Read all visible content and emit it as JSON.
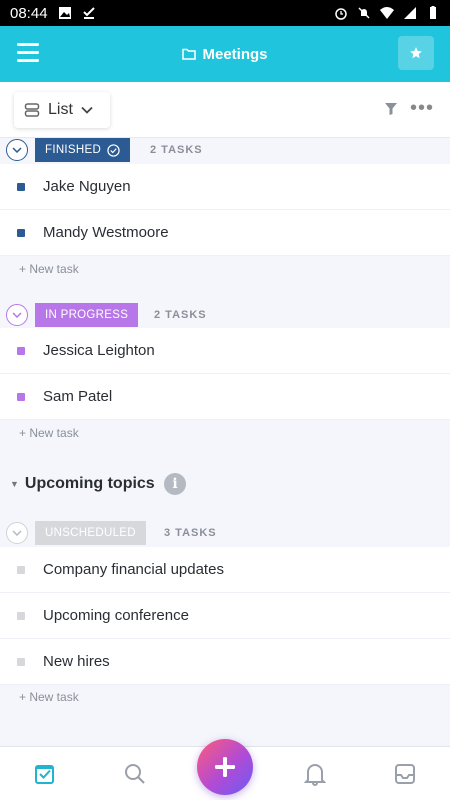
{
  "status_bar": {
    "time": "08:44",
    "left_icons": [
      "image-icon",
      "check-download-icon"
    ],
    "right_icons": [
      "alarm-icon",
      "mute-icon",
      "wifi-icon",
      "signal-icon",
      "battery-icon"
    ]
  },
  "appbar": {
    "title": "Meetings",
    "title_icon": "folder-icon",
    "background": "#20c5dd"
  },
  "toolbar": {
    "view_label": "List",
    "view_icon": "list-view-icon"
  },
  "sections": [
    {
      "status_label": "FINISHED",
      "status_color": "#2c5a92",
      "count_label": "2 TASKS",
      "tasks": [
        "Jake Nguyen",
        "Mandy Westmoore"
      ],
      "new_task_label": "+ New task"
    },
    {
      "status_label": "IN PROGRESS",
      "status_color": "#b877e8",
      "count_label": "2 TASKS",
      "tasks": [
        "Jessica Leighton",
        "Sam Patel"
      ],
      "new_task_label": "+ New task"
    }
  ],
  "group": {
    "title": "Upcoming topics",
    "info_icon": "i",
    "section": {
      "status_label": "UNSCHEDULED",
      "status_color": "#d6d8dc",
      "count_label": "3 TASKS",
      "tasks": [
        "Company financial updates",
        "Upcoming conference",
        "New hires"
      ],
      "new_task_label": "+ New task"
    }
  },
  "bottom_nav": {
    "items": [
      "tasks-icon",
      "search-icon",
      "add-icon",
      "notifications-icon",
      "inbox-icon"
    ],
    "active": "tasks-icon"
  }
}
